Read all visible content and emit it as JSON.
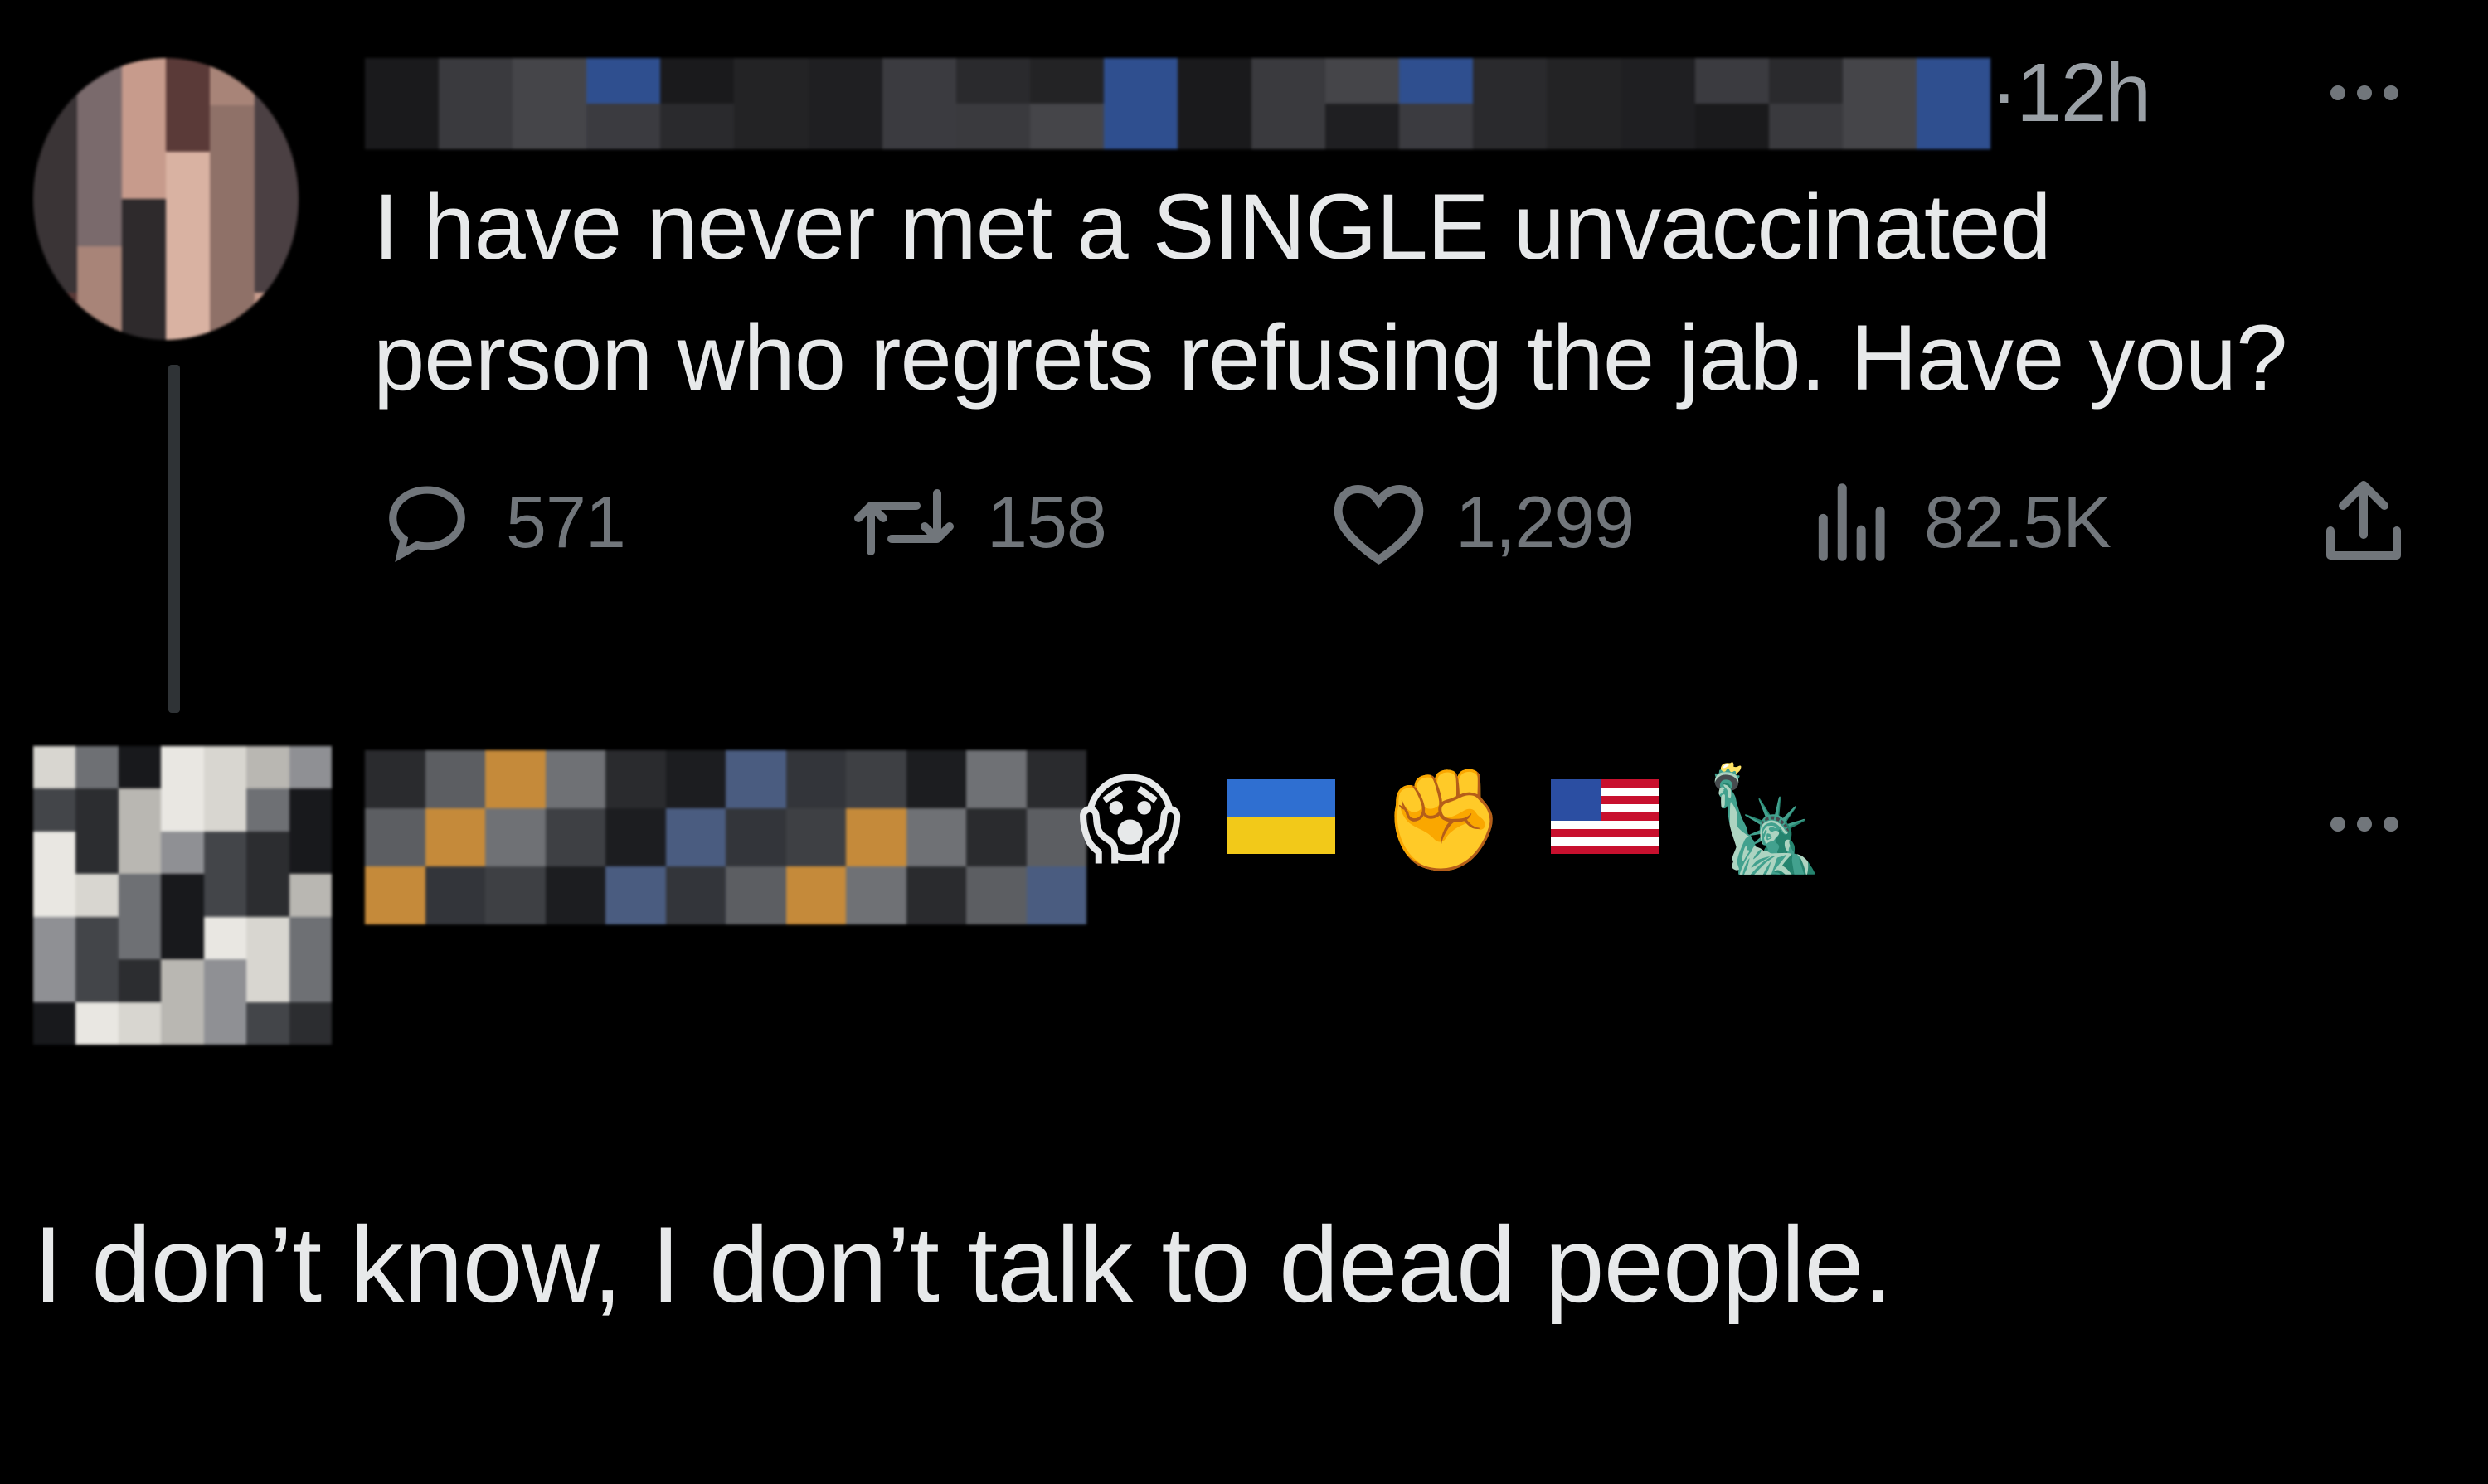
{
  "tweet": {
    "timestamp": "·12h",
    "text_line1": "I have never met a SINGLE unvaccinated",
    "text_line2": "person who regrets refusing the jab. Have you?",
    "stats": {
      "replies": "571",
      "retweets": "158",
      "likes": "1,299",
      "views": "82.5K"
    }
  },
  "reply": {
    "name_emojis": [
      "😱",
      "🇺🇦",
      "✊",
      "🇺🇸",
      "🗽"
    ],
    "text": "I don’t know, I don’t talk to dead people."
  },
  "icons": {
    "reply": "reply-icon",
    "retweet": "retweet-icon",
    "like": "heart-icon",
    "views": "views-icon",
    "share": "share-icon",
    "more": "more-icon"
  },
  "colors": {
    "background": "#000000",
    "text": "#e7e9ea",
    "muted": "#71767b"
  }
}
